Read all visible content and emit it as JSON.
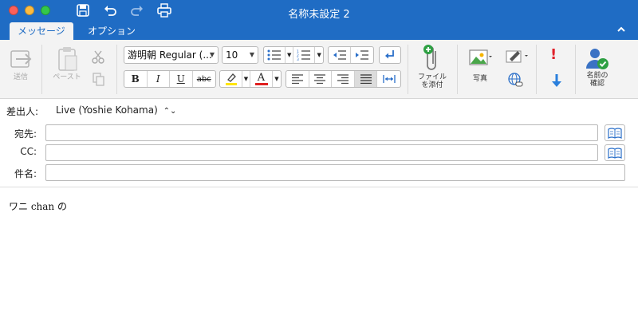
{
  "window": {
    "title": "名称未設定 2"
  },
  "tabs": {
    "message": "メッセージ",
    "options": "オプション"
  },
  "ribbon": {
    "send": "送信",
    "paste": "ペースト",
    "font_name": "游明朝 Regular (...",
    "font_size": "10",
    "bold": "B",
    "italic": "I",
    "underline": "U",
    "strike": "abc",
    "font_color_letter": "A",
    "attach_line1": "ファイル",
    "attach_line2": "を添付",
    "photo": "写真",
    "check_names_line1": "名前の",
    "check_names_line2": "確認"
  },
  "header": {
    "from_label": "差出人:",
    "from_value": "Live (Yoshie Kohama)",
    "to_label": "宛先:",
    "cc_label": "CC:",
    "subject_label": "件名:",
    "to_value": "",
    "cc_value": "",
    "subject_value": ""
  },
  "body": {
    "text": "ワニ chan の"
  },
  "colors": {
    "titlebar": "#1f6cc4",
    "highlight": "#ffe500",
    "font_color": "#e02020",
    "importance_high": "#e0212a",
    "importance_low": "#2a7fdc"
  }
}
